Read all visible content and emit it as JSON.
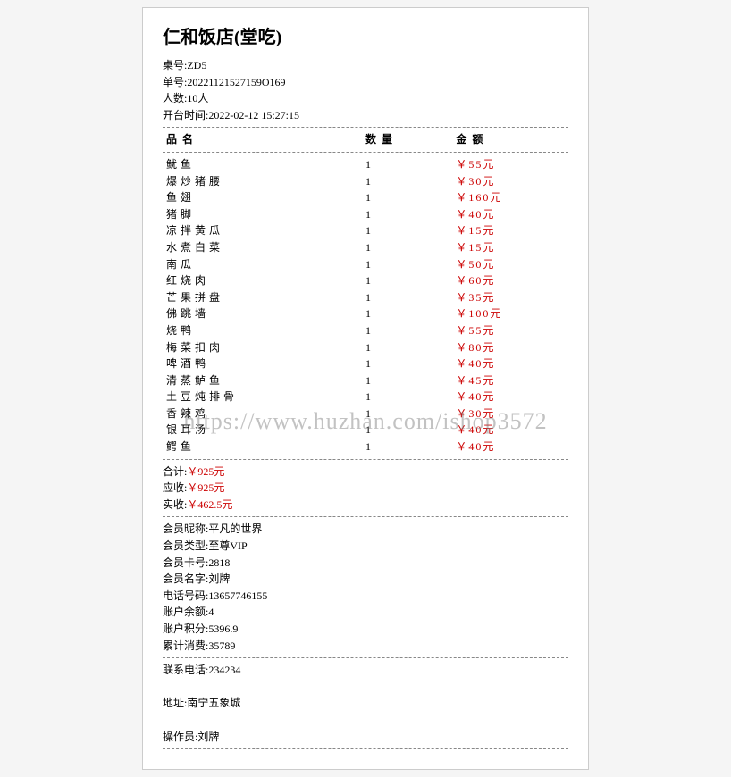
{
  "title": "仁和饭店(堂吃)",
  "header": {
    "table": "桌号:ZD5",
    "orderNo": "单号:20221121527159O169",
    "people": "人数:10人",
    "openTime": "开台时间:2022-02-12 15:27:15"
  },
  "columns": {
    "name": "品名",
    "qty": "数量",
    "amount": "金额"
  },
  "items": [
    {
      "name": "鱿鱼",
      "qty": "1",
      "amount": "￥55元"
    },
    {
      "name": "爆炒猪腰",
      "qty": "1",
      "amount": "￥30元"
    },
    {
      "name": "鱼翅",
      "qty": "1",
      "amount": "￥160元"
    },
    {
      "name": "猪脚",
      "qty": "1",
      "amount": "￥40元"
    },
    {
      "name": "凉拌黄瓜",
      "qty": "1",
      "amount": "￥15元"
    },
    {
      "name": "水煮白菜",
      "qty": "1",
      "amount": "￥15元"
    },
    {
      "name": "南瓜",
      "qty": "1",
      "amount": "￥50元"
    },
    {
      "name": "红烧肉",
      "qty": "1",
      "amount": "￥60元"
    },
    {
      "name": "芒果拼盘",
      "qty": "1",
      "amount": "￥35元"
    },
    {
      "name": "佛跳墙",
      "qty": "1",
      "amount": "￥100元"
    },
    {
      "name": "烧鸭",
      "qty": "1",
      "amount": "￥55元"
    },
    {
      "name": "梅菜扣肉",
      "qty": "1",
      "amount": "￥80元"
    },
    {
      "name": "啤酒鸭",
      "qty": "1",
      "amount": "￥40元"
    },
    {
      "name": "清蒸鲈鱼",
      "qty": "1",
      "amount": "￥45元"
    },
    {
      "name": "土豆炖排骨",
      "qty": "1",
      "amount": "￥40元"
    },
    {
      "name": "香辣鸡",
      "qty": "1",
      "amount": "￥30元"
    },
    {
      "name": "银耳汤",
      "qty": "1",
      "amount": "￥40元"
    },
    {
      "name": "鳄鱼",
      "qty": "1",
      "amount": "￥40元"
    }
  ],
  "totals": {
    "sumLabel": "合计:",
    "sumValue": "￥925元",
    "receivableLabel": "应收:",
    "receivableValue": "￥925元",
    "paidLabel": "实收:",
    "paidValue": "￥462.5元"
  },
  "member": {
    "nickname": "会员昵称:平凡的世界",
    "type": "会员类型:至尊VIP",
    "cardNo": "会员卡号:2818",
    "name": "会员名字:刘牌",
    "phone": "电话号码:13657746155",
    "balance": "账户余额:4",
    "points": "账户积分:5396.9",
    "totalSpend": "累计消费:35789"
  },
  "footer": {
    "contact": "联系电话:234234",
    "address": "地址:南宁五象城",
    "operator": "操作员:刘牌"
  },
  "watermark": "https://www.huzhan.com/ishop3572"
}
